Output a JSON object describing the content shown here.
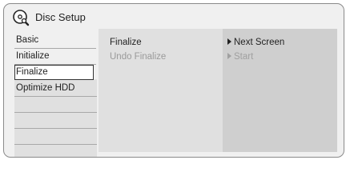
{
  "header": {
    "title": "Disc Setup",
    "icon": "disc-setup-icon"
  },
  "sidebar": {
    "items": [
      {
        "label": "Basic"
      },
      {
        "label": "Initialize"
      },
      {
        "label": "Finalize",
        "selected": true
      },
      {
        "label": "Optimize HDD"
      }
    ]
  },
  "options": {
    "items": [
      {
        "label": "Finalize",
        "enabled": true
      },
      {
        "label": "Undo Finalize",
        "enabled": false
      }
    ]
  },
  "actions": {
    "items": [
      {
        "label": "Next Screen",
        "enabled": true
      },
      {
        "label": "Start",
        "enabled": false
      }
    ]
  }
}
